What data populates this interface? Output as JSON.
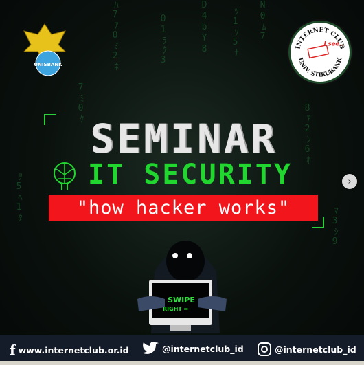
{
  "post": {
    "title": "SEMINAR",
    "subtitle": "IT SECURITY",
    "tagline": "\"how hacker works\"",
    "swipe_line1": "SWIPE",
    "swipe_line2": "RIGHT",
    "logos": {
      "left": "UNISBANK",
      "right_top": "INTERNET CLUB",
      "right_bottom": "UNIV. STIKUBANK",
      "right_chip": "I see.."
    },
    "colors": {
      "accent_green": "#22d630",
      "tagline_red": "#f2151b",
      "footer_bg": "#141b29"
    }
  },
  "footer": {
    "website": "www.internetclub.or.id",
    "twitter": "@internetclub_id",
    "instagram": "@internetclub_id",
    "icons": [
      "facebook-icon",
      "twitter-icon",
      "instagram-icon"
    ]
  },
  "carousel": {
    "next_icon": "chevron-right-icon"
  }
}
